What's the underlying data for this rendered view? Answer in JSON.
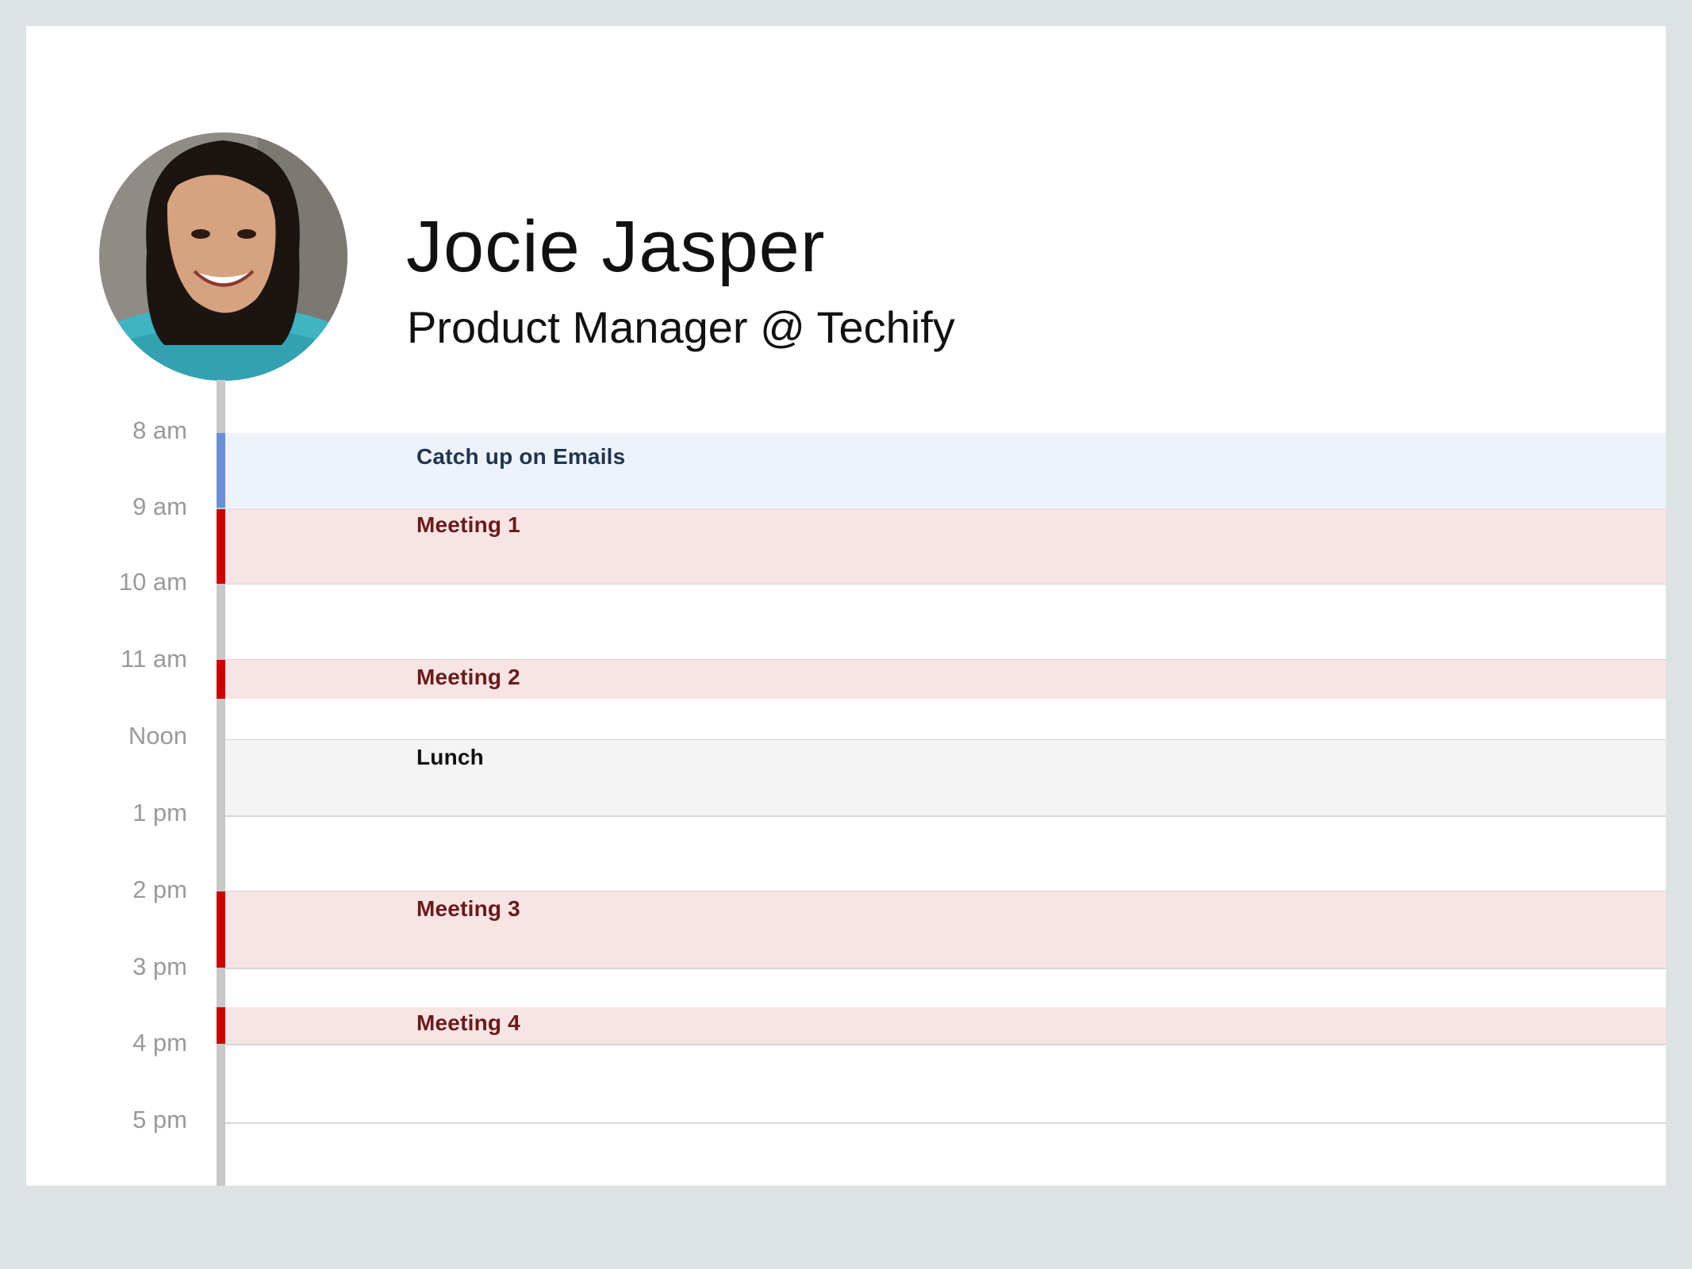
{
  "profile": {
    "name": "Jocie Jasper",
    "role": "Product Manager @ Techify",
    "avatar_icon": "profile-photo"
  },
  "hours": [
    "8 am",
    "9 am",
    "10 am",
    "11 am",
    "Noon",
    "1 pm",
    "2 pm",
    "3 pm",
    "4 pm",
    "5 pm"
  ],
  "events": [
    {
      "title": "Catch up on Emails",
      "start": "8:00",
      "end": "9:00",
      "kind": "personal"
    },
    {
      "title": "Meeting 1",
      "start": "9:00",
      "end": "10:00",
      "kind": "meeting"
    },
    {
      "title": "Meeting 2",
      "start": "11:00",
      "end": "11:30",
      "kind": "meeting"
    },
    {
      "title": "Lunch",
      "start": "12:00",
      "end": "13:00",
      "kind": "break"
    },
    {
      "title": "Meeting 3",
      "start": "14:00",
      "end": "15:00",
      "kind": "meeting"
    },
    {
      "title": "Meeting 4",
      "start": "15:30",
      "end": "16:00",
      "kind": "meeting"
    }
  ],
  "colors": {
    "background": "#dde3e3",
    "card": "#ffffff",
    "timeline": "#c8c8c8",
    "hour_label": "#9a9a9a",
    "personal_fill": "#edf2fb",
    "personal_accent": "#6a8fd6",
    "personal_text": "#1f3550",
    "meeting_fill": "#f8e4e4",
    "meeting_accent": "#cc0000",
    "meeting_text": "#6b1a1a",
    "break_fill": "#f4f4f4",
    "break_text": "#111111"
  }
}
